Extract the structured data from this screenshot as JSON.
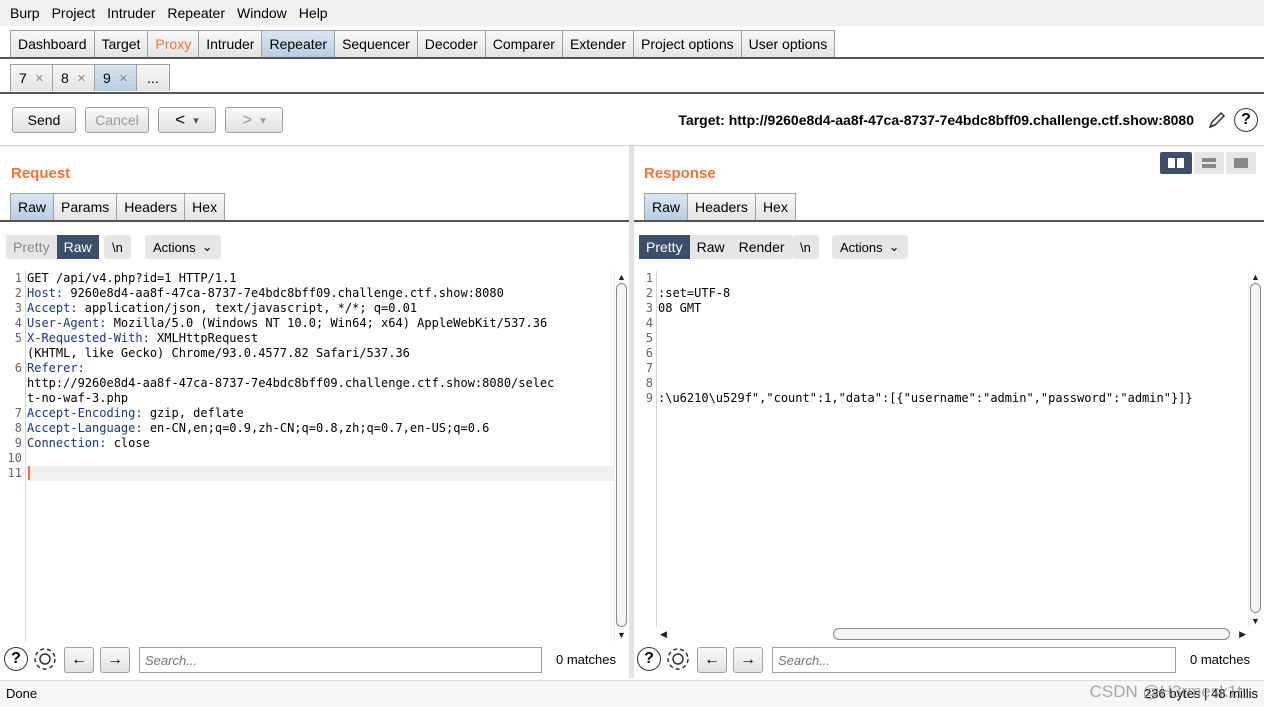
{
  "menu": [
    "Burp",
    "Project",
    "Intruder",
    "Repeater",
    "Window",
    "Help"
  ],
  "main_tabs": [
    "Dashboard",
    "Target",
    "Proxy",
    "Intruder",
    "Repeater",
    "Sequencer",
    "Decoder",
    "Comparer",
    "Extender",
    "Project options",
    "User options"
  ],
  "sub_tabs": [
    "7",
    "8",
    "9",
    "..."
  ],
  "toolbar": {
    "send": "Send",
    "cancel": "Cancel",
    "prev": "<",
    "next": ">",
    "dropdown": "▾",
    "target": "Target: http://9260e8d4-aa8f-47ca-8737-7e4bdc8bff09.challenge.ctf.show:8080"
  },
  "request": {
    "title": "Request",
    "tabs": [
      "Raw",
      "Params",
      "Headers",
      "Hex"
    ],
    "view": [
      "Pretty",
      "Raw"
    ],
    "newline": "\\n",
    "actions": "Actions",
    "line_numbers": [
      "1",
      "2",
      "3",
      "4",
      "5",
      "",
      "6",
      "",
      "",
      "7",
      "8",
      "9",
      "10",
      "11"
    ],
    "lines": [
      {
        "k": "",
        "v": "GET /api/v4.php?id=1 HTTP/1.1"
      },
      {
        "k": "Host:",
        "v": " 9260e8d4-aa8f-47ca-8737-7e4bdc8bff09.challenge.ctf.show:8080"
      },
      {
        "k": "Accept:",
        "v": " application/json, text/javascript, */*; q=0.01"
      },
      {
        "k": "User-Agent:",
        "v": " Mozilla/5.0 (Windows NT 10.0; Win64; x64) AppleWebKit/537.36"
      },
      {
        "k": "X-Requested-With:",
        "v": " XMLHttpRequest"
      },
      {
        "k": "",
        "v": "(KHTML, like Gecko) Chrome/93.0.4577.82 Safari/537.36"
      },
      {
        "k": "Referer:",
        "v": ""
      },
      {
        "k": "",
        "v": "http://9260e8d4-aa8f-47ca-8737-7e4bdc8bff09.challenge.ctf.show:8080/selec"
      },
      {
        "k": "",
        "v": "t-no-waf-3.php"
      },
      {
        "k": "Accept-Encoding:",
        "v": " gzip, deflate"
      },
      {
        "k": "Accept-Language:",
        "v": " en-CN,en;q=0.9,zh-CN;q=0.8,zh;q=0.7,en-US;q=0.6"
      },
      {
        "k": "Connection:",
        "v": " close"
      },
      {
        "k": "",
        "v": ""
      },
      {
        "k": "",
        "v": ""
      }
    ],
    "search_placeholder": "Search...",
    "matches": "0 matches"
  },
  "response": {
    "title": "Response",
    "tabs": [
      "Raw",
      "Headers",
      "Hex"
    ],
    "view": [
      "Pretty",
      "Raw",
      "Render"
    ],
    "newline": "\\n",
    "actions": "Actions",
    "line_numbers": [
      "1",
      "2",
      "3",
      "4",
      "5",
      "6",
      "7",
      "8",
      "9"
    ],
    "lines": [
      "",
      ":set=UTF-8",
      "08 GMT",
      "",
      "",
      "",
      "",
      "",
      ":\\u6210\\u529f\",\"count\":1,\"data\":[{\"username\":\"admin\",\"password\":\"admin\"}]}"
    ],
    "search_placeholder": "Search...",
    "matches": "0 matches"
  },
  "status": {
    "left": "Done",
    "right": "236 bytes | 48 millis",
    "watermark": "CSDN @H3rmesk1t"
  }
}
